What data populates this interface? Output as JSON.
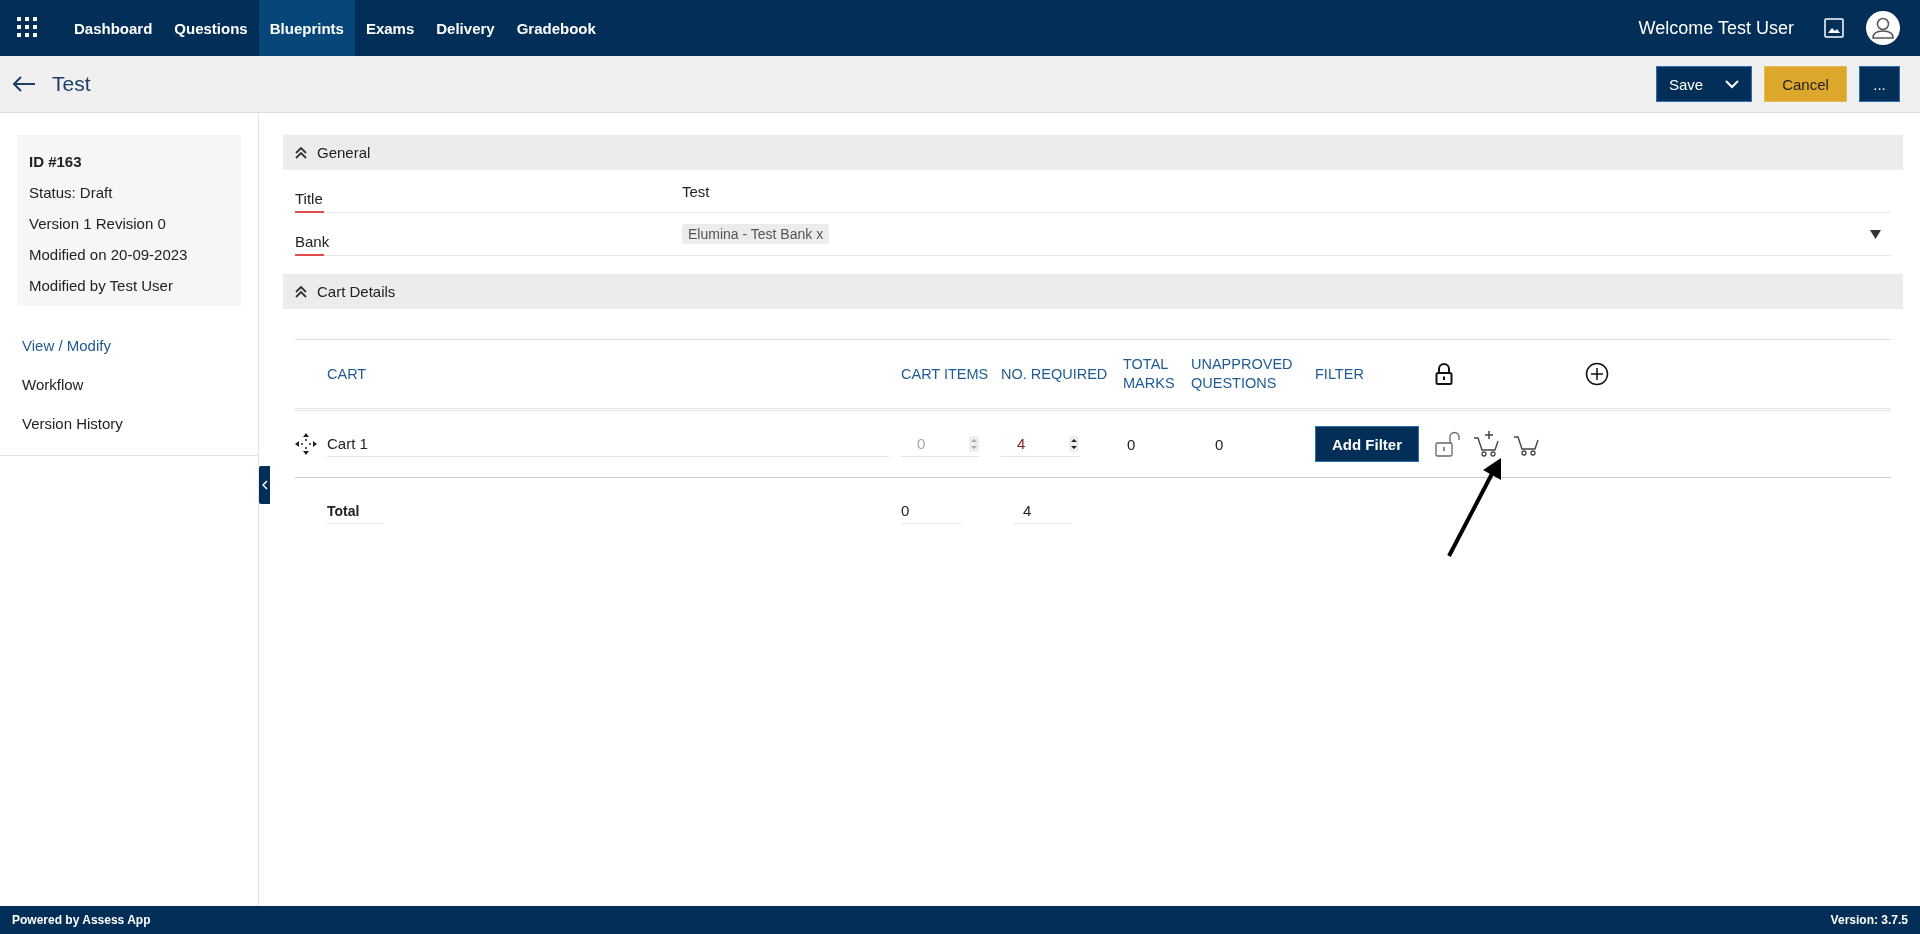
{
  "nav": {
    "items": [
      {
        "label": "Dashboard",
        "selected": false
      },
      {
        "label": "Questions",
        "selected": false
      },
      {
        "label": "Blueprints",
        "selected": true
      },
      {
        "label": "Exams",
        "selected": false
      },
      {
        "label": "Delivery",
        "selected": false
      },
      {
        "label": "Gradebook",
        "selected": false
      }
    ],
    "welcome": "Welcome Test User"
  },
  "header": {
    "title": "Test",
    "save": "Save",
    "cancel": "Cancel",
    "more": "..."
  },
  "info": {
    "id": "ID #163",
    "lines": [
      "Status: Draft",
      "Version 1 Revision 0",
      "Modified on 20-09-2023",
      "Modified by Test User"
    ]
  },
  "sidebar": {
    "items": [
      {
        "label": "View / Modify",
        "selected": true
      },
      {
        "label": "Workflow",
        "selected": false
      },
      {
        "label": "Version History",
        "selected": false
      }
    ]
  },
  "general": {
    "heading": "General",
    "title_label": "Title",
    "title_value": "Test",
    "bank_label": "Bank",
    "bank_chip": "Elumina - Test Bank x"
  },
  "cart_details": {
    "heading": "Cart Details",
    "columns": [
      "CART",
      "CART ITEMS",
      "NO. REQUIRED",
      "TOTAL MARKS",
      "UNAPPROVED QUESTIONS",
      "FILTER"
    ],
    "rows": [
      {
        "name": "Cart 1",
        "cart_items": "0",
        "cart_items_disabled": true,
        "required": "4",
        "total_marks": "0",
        "unapproved": "0",
        "filter_button": "Add Filter"
      }
    ],
    "total": {
      "label": "Total",
      "cart_items": "0",
      "required": "4"
    }
  },
  "footer": {
    "left": "Powered by Assess App",
    "right": "Version: **3.7.5**"
  }
}
